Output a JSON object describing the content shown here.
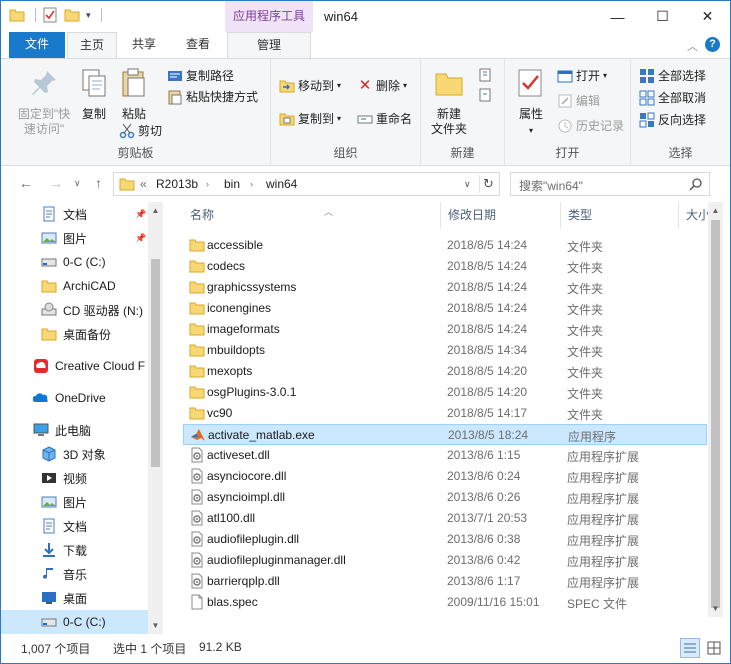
{
  "titlebar": {
    "context_tab": "应用程序工具",
    "title": "win64",
    "minimize": "—",
    "maximize": "☐",
    "close": "✕"
  },
  "ribbon_tabs": {
    "file": "文件",
    "home": "主页",
    "share": "共享",
    "view": "查看",
    "manage": "管理"
  },
  "ribbon": {
    "clipboard": {
      "label": "剪贴板",
      "pin_quick_access": "固定到\"快速访问\"",
      "copy": "复制",
      "paste": "粘贴",
      "copy_path": "复制路径",
      "paste_shortcut": "粘贴快捷方式",
      "cut": "剪切"
    },
    "organize": {
      "label": "组织",
      "move_to": "移动到",
      "copy_to": "复制到",
      "delete": "删除",
      "rename": "重命名"
    },
    "new": {
      "label": "新建",
      "new_folder": "新建\n文件夹"
    },
    "open": {
      "label": "打开",
      "properties": "属性",
      "open": "打开",
      "edit": "编辑",
      "history": "历史记录"
    },
    "select": {
      "label": "选择",
      "select_all": "全部选择",
      "select_none": "全部取消",
      "invert": "反向选择"
    }
  },
  "address": {
    "prefix": "«",
    "crumbs": [
      "R2013b",
      "bin",
      "win64"
    ],
    "search_placeholder": "搜索\"win64\""
  },
  "nav_pane": {
    "items": [
      {
        "label": "文档",
        "icon": "documents-icon",
        "pinned": true
      },
      {
        "label": "图片",
        "icon": "pictures-icon",
        "pinned": true
      },
      {
        "label": "0-C (C:)",
        "icon": "drive-icon",
        "pinned": false
      },
      {
        "label": "ArchiCAD",
        "icon": "folder-icon",
        "pinned": false
      },
      {
        "label": "CD 驱动器 (N:)",
        "icon": "cd-drive-icon",
        "pinned": false
      },
      {
        "label": "桌面备份",
        "icon": "folder-icon",
        "pinned": false
      },
      {
        "label": "Creative Cloud F",
        "icon": "creative-cloud-icon",
        "pinned": false
      },
      {
        "label": "OneDrive",
        "icon": "onedrive-icon",
        "pinned": false
      },
      {
        "label": "此电脑",
        "icon": "this-pc-icon",
        "pinned": false
      },
      {
        "label": "3D 对象",
        "icon": "3d-objects-icon",
        "pinned": false
      },
      {
        "label": "视频",
        "icon": "videos-icon",
        "pinned": false
      },
      {
        "label": "图片",
        "icon": "pictures-icon",
        "pinned": false
      },
      {
        "label": "文档",
        "icon": "documents-icon",
        "pinned": false
      },
      {
        "label": "下载",
        "icon": "downloads-icon",
        "pinned": false
      },
      {
        "label": "音乐",
        "icon": "music-icon",
        "pinned": false
      },
      {
        "label": "桌面",
        "icon": "desktop-icon",
        "pinned": false
      },
      {
        "label": "0-C (C:)",
        "icon": "drive-icon",
        "pinned": false
      }
    ]
  },
  "columns": {
    "name": "名称",
    "date": "修改日期",
    "type": "类型",
    "size": "大小"
  },
  "files": [
    {
      "name": "accessible",
      "date": "2018/8/5 14:24",
      "type": "文件夹",
      "icon": "folder-icon"
    },
    {
      "name": "codecs",
      "date": "2018/8/5 14:24",
      "type": "文件夹",
      "icon": "folder-icon"
    },
    {
      "name": "graphicssystems",
      "date": "2018/8/5 14:24",
      "type": "文件夹",
      "icon": "folder-icon"
    },
    {
      "name": "iconengines",
      "date": "2018/8/5 14:24",
      "type": "文件夹",
      "icon": "folder-icon"
    },
    {
      "name": "imageformats",
      "date": "2018/8/5 14:24",
      "type": "文件夹",
      "icon": "folder-icon"
    },
    {
      "name": "mbuildopts",
      "date": "2018/8/5 14:34",
      "type": "文件夹",
      "icon": "folder-icon"
    },
    {
      "name": "mexopts",
      "date": "2018/8/5 14:20",
      "type": "文件夹",
      "icon": "folder-icon"
    },
    {
      "name": "osgPlugins-3.0.1",
      "date": "2018/8/5 14:20",
      "type": "文件夹",
      "icon": "folder-icon"
    },
    {
      "name": "vc90",
      "date": "2018/8/5 14:17",
      "type": "文件夹",
      "icon": "folder-icon"
    },
    {
      "name": "activate_matlab.exe",
      "date": "2013/8/5 18:24",
      "type": "应用程序",
      "icon": "matlab-icon",
      "selected": true
    },
    {
      "name": "activeset.dll",
      "date": "2013/8/6 1:15",
      "type": "应用程序扩展",
      "icon": "dll-icon"
    },
    {
      "name": "asynciocore.dll",
      "date": "2013/8/6 0:24",
      "type": "应用程序扩展",
      "icon": "dll-icon"
    },
    {
      "name": "asyncioimpl.dll",
      "date": "2013/8/6 0:26",
      "type": "应用程序扩展",
      "icon": "dll-icon"
    },
    {
      "name": "atl100.dll",
      "date": "2013/7/1 20:53",
      "type": "应用程序扩展",
      "icon": "dll-icon"
    },
    {
      "name": "audiofileplugin.dll",
      "date": "2013/8/6 0:38",
      "type": "应用程序扩展",
      "icon": "dll-icon"
    },
    {
      "name": "audiofilepluginmanager.dll",
      "date": "2013/8/6 0:42",
      "type": "应用程序扩展",
      "icon": "dll-icon"
    },
    {
      "name": "barrierqplp.dll",
      "date": "2013/8/6 1:17",
      "type": "应用程序扩展",
      "icon": "dll-icon"
    },
    {
      "name": "blas.spec",
      "date": "2009/11/16 15:01",
      "type": "SPEC 文件",
      "icon": "file-icon"
    }
  ],
  "status": {
    "count": "1,007 个项目",
    "selected": "选中 1 个项目",
    "size": "91.2 KB"
  }
}
